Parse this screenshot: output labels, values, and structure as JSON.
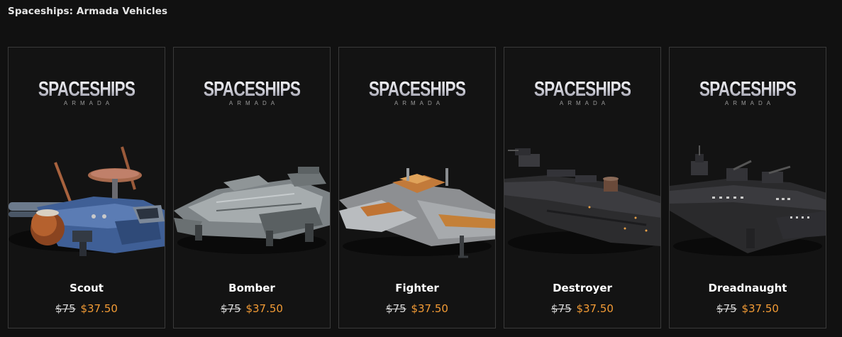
{
  "section": {
    "title": "Spaceships: Armada Vehicles"
  },
  "brand": {
    "logo_main": "SPACESHIPS",
    "logo_sub": "ARMADA"
  },
  "colors": {
    "background": "#111111",
    "card_border": "#3a3a3a",
    "sale_price": "#f29b35",
    "text": "#ffffff"
  },
  "products": [
    {
      "name": "Scout",
      "old_price": "$75",
      "new_price": "$37.50",
      "image": "scout-ship"
    },
    {
      "name": "Bomber",
      "old_price": "$75",
      "new_price": "$37.50",
      "image": "bomber-ship"
    },
    {
      "name": "Fighter",
      "old_price": "$75",
      "new_price": "$37.50",
      "image": "fighter-ship"
    },
    {
      "name": "Destroyer",
      "old_price": "$75",
      "new_price": "$37.50",
      "image": "destroyer-ship"
    },
    {
      "name": "Dreadnaught",
      "old_price": "$75",
      "new_price": "$37.50",
      "image": "dreadnaught-ship"
    }
  ]
}
